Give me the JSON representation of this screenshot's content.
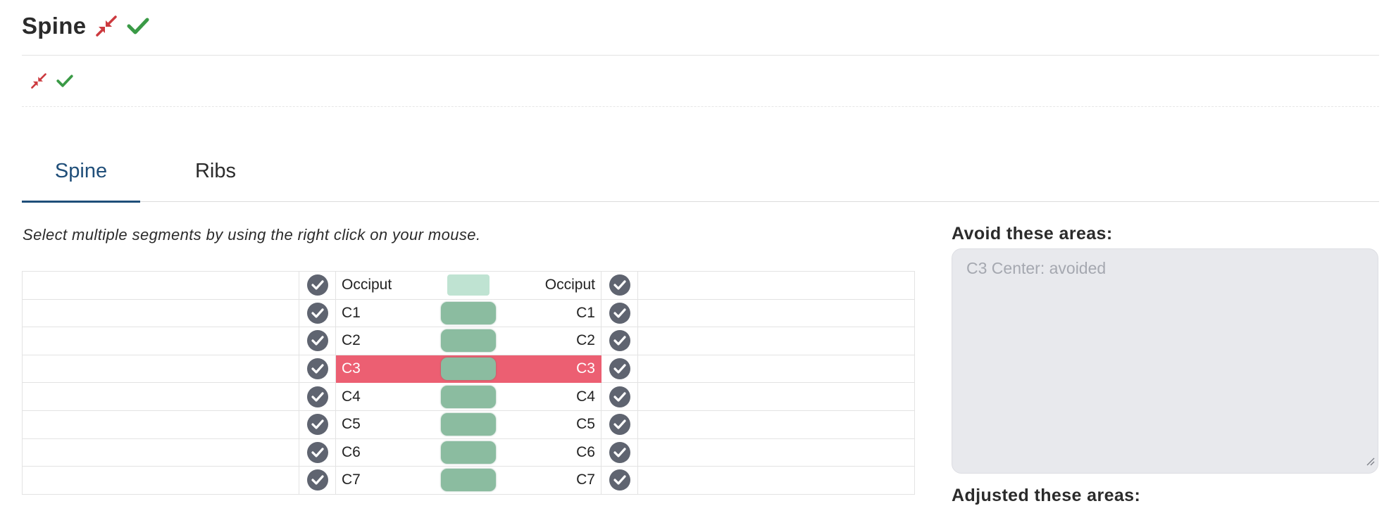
{
  "header": {
    "title": "Spine"
  },
  "tabs": [
    {
      "label": "Spine",
      "active": true
    },
    {
      "label": "Ribs",
      "active": false
    }
  ],
  "instruction": "Select multiple segments by using the right click on your mouse.",
  "segments": [
    {
      "label": "Occiput",
      "selected": false
    },
    {
      "label": "C1",
      "selected": false
    },
    {
      "label": "C2",
      "selected": false
    },
    {
      "label": "C3",
      "selected": true
    },
    {
      "label": "C4",
      "selected": false
    },
    {
      "label": "C5",
      "selected": false
    },
    {
      "label": "C6",
      "selected": false
    },
    {
      "label": "C7",
      "selected": false
    }
  ],
  "avoid": {
    "label": "Avoid these areas:",
    "placeholder": "C3 Center: avoided"
  },
  "adjusted": {
    "label": "Adjusted these areas:"
  },
  "colors": {
    "accent": "#1f4e79",
    "selected_row": "#ec5f72",
    "vertebra": "#8bbca0",
    "collapse_icon": "#cc3a3f",
    "check_icon": "#3a9a46",
    "checkbox": "#5f6470"
  },
  "icons": {
    "collapse": "compress-arrows-icon",
    "confirm": "check-icon",
    "row_check": "check-circle-icon"
  }
}
